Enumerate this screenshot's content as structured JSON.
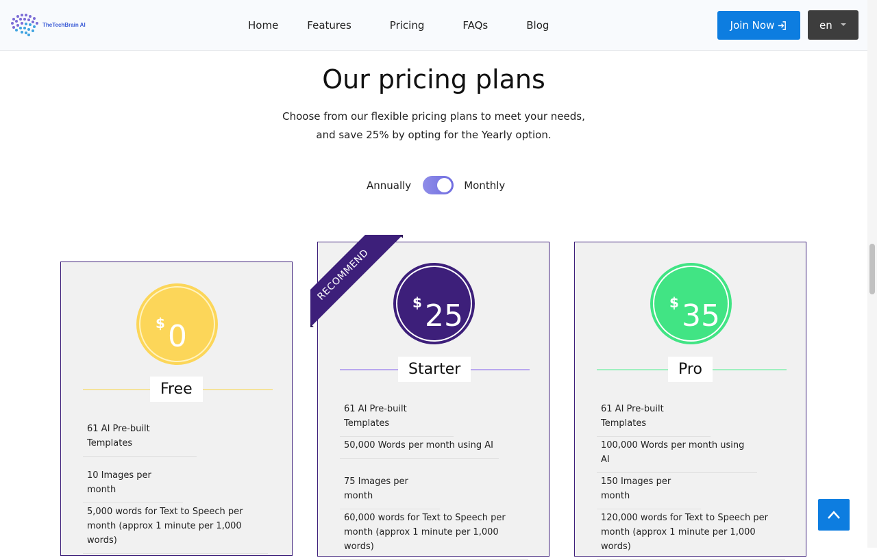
{
  "brand": {
    "name": "TheTechBrain AI"
  },
  "nav": {
    "items": [
      "Home",
      "Features",
      "Pricing",
      "FAQs",
      "Blog"
    ]
  },
  "header": {
    "join_label": "Join Now",
    "language": "en"
  },
  "hero": {
    "title": "Our pricing plans",
    "subtitle_line1": "Choose from our flexible pricing plans to meet your needs,",
    "subtitle_line2": "and save 25% by opting for the Yearly option."
  },
  "billing_toggle": {
    "left_label": "Annually",
    "right_label": "Monthly",
    "selected": "Monthly"
  },
  "plans": [
    {
      "name": "Free",
      "currency": "$",
      "price": "0",
      "color": "#fcd659",
      "features": [
        "61 AI Pre-built Templates",
        "10 Images per month",
        "5,000 words for Text to Speech per month (approx 1 minute per 1,000 words)"
      ]
    },
    {
      "name": "Starter",
      "currency": "$",
      "price": "25",
      "color": "#3d1f7a",
      "ribbon": "RECOMMEND",
      "features": [
        "61 AI Pre-built Templates",
        "50,000 Words per month using AI",
        "75 Images per month",
        "60,000 words for Text to Speech per month (approx 1 minute per 1,000 words)"
      ]
    },
    {
      "name": "Pro",
      "currency": "$",
      "price": "35",
      "color": "#41e484",
      "features": [
        "61 AI Pre-built Templates",
        "100,000 Words per month using AI",
        "150 Images per month",
        "120,000 words for Text to Speech per month (approx 1 minute per 1,000 words)"
      ]
    }
  ],
  "colors": {
    "primary": "#0d7de0",
    "accent": "#3d1f7a"
  }
}
